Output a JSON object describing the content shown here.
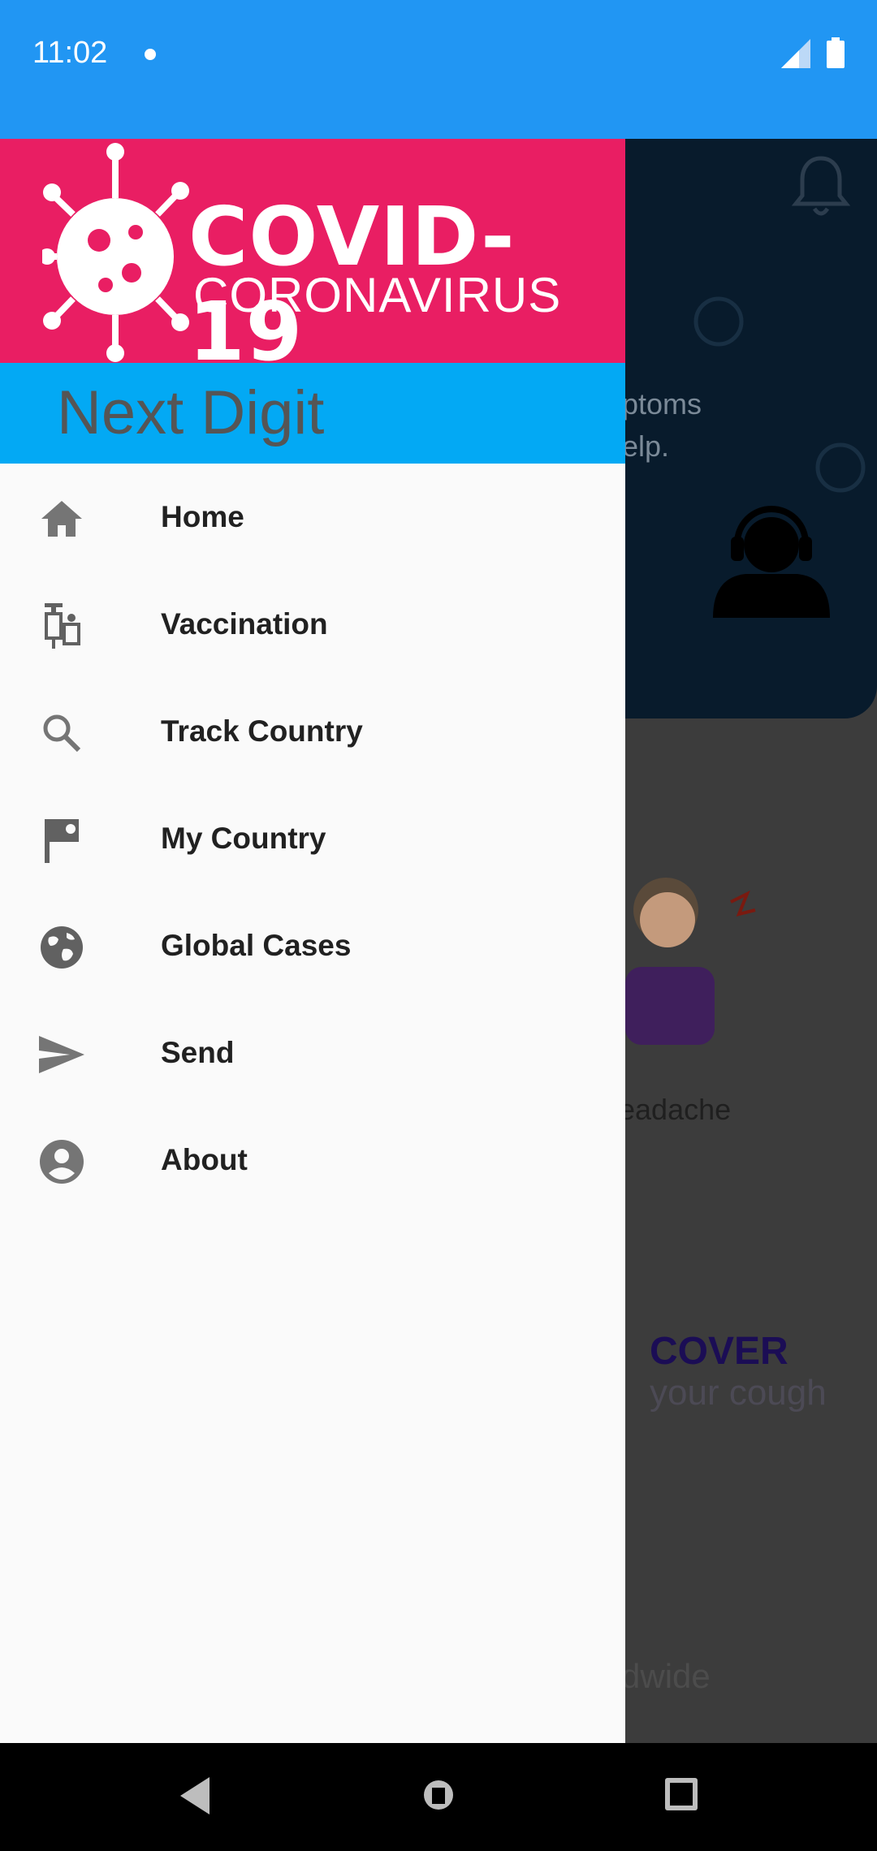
{
  "status_bar": {
    "time": "11:02",
    "icons": [
      "notification-dot-icon",
      "signal-icon",
      "battery-icon"
    ]
  },
  "background": {
    "text_symptoms": "ptoms",
    "text_help": "elp.",
    "headache_label": "eadache",
    "cover_title": "COVER",
    "cover_sub": "your cough",
    "worldwide": "dwide"
  },
  "drawer": {
    "banner_title": "COVID-19",
    "banner_subtitle": "CORONAVIRUS",
    "app_name": "Next Digit",
    "items": [
      {
        "label": "Home",
        "icon": "home-icon"
      },
      {
        "label": "Vaccination",
        "icon": "syringe-icon"
      },
      {
        "label": "Track Country",
        "icon": "search-icon"
      },
      {
        "label": "My Country",
        "icon": "flag-icon"
      },
      {
        "label": "Global Cases",
        "icon": "globe-icon"
      },
      {
        "label": "Send",
        "icon": "send-icon"
      },
      {
        "label": "About",
        "icon": "account-circle-icon"
      }
    ]
  },
  "colors": {
    "status_bar": "#2196F3",
    "banner": "#e91e63",
    "subheader": "#03a9f4",
    "drawer_bg": "#fafafa"
  },
  "nav_bar": {
    "buttons": [
      "back-icon",
      "home-nav-icon",
      "recents-icon"
    ]
  }
}
